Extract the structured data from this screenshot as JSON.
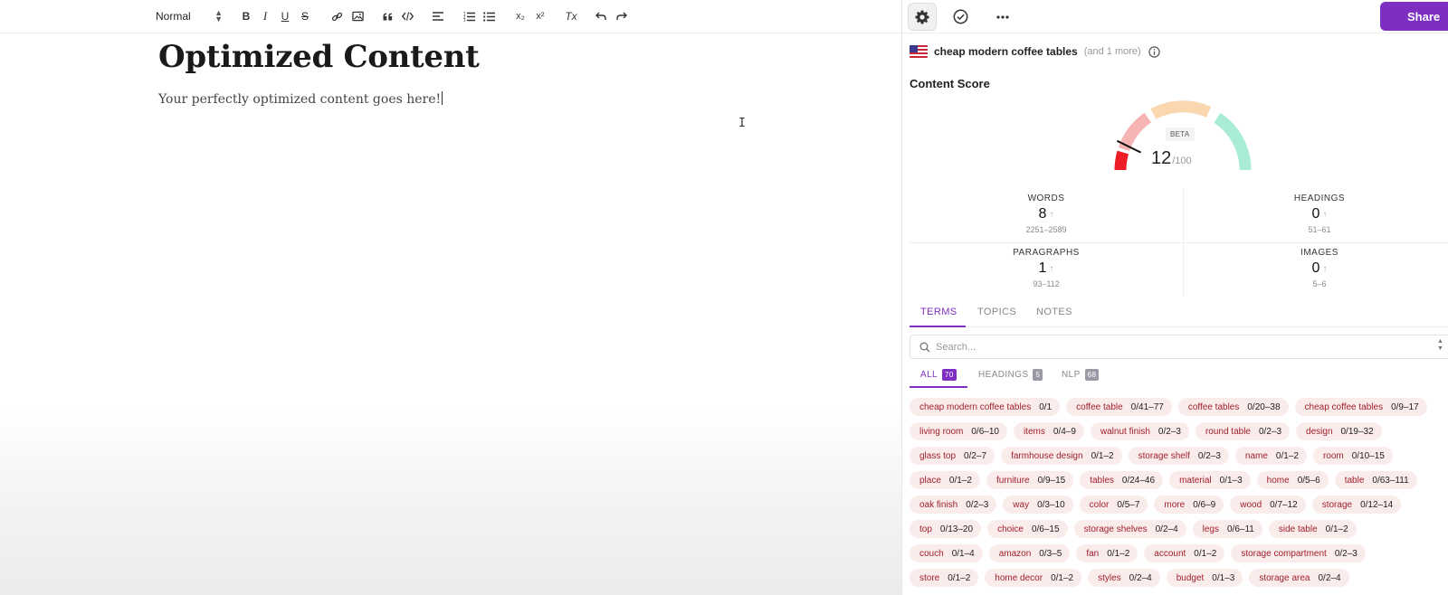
{
  "toolbar": {
    "format_select": "Normal",
    "bold": "B",
    "italic": "I",
    "underline": "U",
    "strike": "S",
    "subscript": "x₂",
    "superscript": "x²",
    "clear_format": "Tx"
  },
  "doc": {
    "title": "Optimized Content",
    "body": "Your perfectly optimized content goes here!"
  },
  "panel": {
    "share_label": "Share",
    "keyword": "cheap modern coffee tables",
    "keyword_more": "(and 1 more)",
    "content_score_title": "Content Score",
    "beta_label": "BETA",
    "score": "12",
    "score_max": "/100",
    "score_fraction": 0.12,
    "stats": {
      "words": {
        "label": "WORDS",
        "value": "8",
        "range": "2251–2589"
      },
      "headings": {
        "label": "HEADINGS",
        "value": "0",
        "range": "51–61"
      },
      "paragraphs": {
        "label": "PARAGRAPHS",
        "value": "1",
        "range": "93–112"
      },
      "images": {
        "label": "IMAGES",
        "value": "0",
        "range": "5–6"
      }
    },
    "tabs": [
      "TERMS",
      "TOPICS",
      "NOTES"
    ],
    "search_placeholder": "Search...",
    "subtabs": [
      {
        "label": "ALL",
        "count": "70"
      },
      {
        "label": "HEADINGS",
        "count": "5"
      },
      {
        "label": "NLP",
        "count": "68"
      }
    ]
  },
  "terms": [
    [
      [
        "cheap modern coffee tables",
        "0/1"
      ],
      [
        "coffee table",
        "0/41–77"
      ],
      [
        "coffee tables",
        "0/20–38"
      ],
      [
        "cheap coffee tables",
        "0/9–17"
      ]
    ],
    [
      [
        "living room",
        "0/6–10"
      ],
      [
        "items",
        "0/4–9"
      ],
      [
        "walnut finish",
        "0/2–3"
      ],
      [
        "round table",
        "0/2–3"
      ],
      [
        "design",
        "0/19–32"
      ]
    ],
    [
      [
        "glass top",
        "0/2–7"
      ],
      [
        "farmhouse design",
        "0/1–2"
      ],
      [
        "storage shelf",
        "0/2–3"
      ],
      [
        "name",
        "0/1–2"
      ],
      [
        "room",
        "0/10–15"
      ]
    ],
    [
      [
        "place",
        "0/1–2"
      ],
      [
        "furniture",
        "0/9–15"
      ],
      [
        "tables",
        "0/24–46"
      ],
      [
        "material",
        "0/1–3"
      ],
      [
        "home",
        "0/5–6"
      ],
      [
        "table",
        "0/63–111"
      ]
    ],
    [
      [
        "oak finish",
        "0/2–3"
      ],
      [
        "way",
        "0/3–10"
      ],
      [
        "color",
        "0/5–7"
      ],
      [
        "more",
        "0/6–9"
      ],
      [
        "wood",
        "0/7–12"
      ],
      [
        "storage",
        "0/12–14"
      ]
    ],
    [
      [
        "top",
        "0/13–20"
      ],
      [
        "choice",
        "0/6–15"
      ],
      [
        "storage shelves",
        "0/2–4"
      ],
      [
        "legs",
        "0/6–11"
      ],
      [
        "side table",
        "0/1–2"
      ]
    ],
    [
      [
        "couch",
        "0/1–4"
      ],
      [
        "amazon",
        "0/3–5"
      ],
      [
        "fan",
        "0/1–2"
      ],
      [
        "account",
        "0/1–2"
      ],
      [
        "storage compartment",
        "0/2–3"
      ]
    ],
    [
      [
        "store",
        "0/1–2"
      ],
      [
        "home decor",
        "0/1–2"
      ],
      [
        "styles",
        "0/2–4"
      ],
      [
        "budget",
        "0/1–3"
      ],
      [
        "storage area",
        "0/2–4"
      ]
    ]
  ],
  "colors": {
    "accent": "#7d2fc1",
    "term_text": "#a0202b",
    "term_bg": "#fbecec",
    "gauge_red": "#ee1c25",
    "gauge_pink": "#f7b4b4",
    "gauge_peach": "#fbd7b0",
    "gauge_mint": "#a8ecd4"
  },
  "icons": [
    "gear-icon",
    "check-circle-icon",
    "more-icon",
    "info-icon",
    "search-icon",
    "link-icon",
    "image-icon",
    "quote-icon",
    "code-icon",
    "align-icon",
    "ordered-list-icon",
    "bullet-list-icon",
    "undo-icon",
    "redo-icon"
  ]
}
